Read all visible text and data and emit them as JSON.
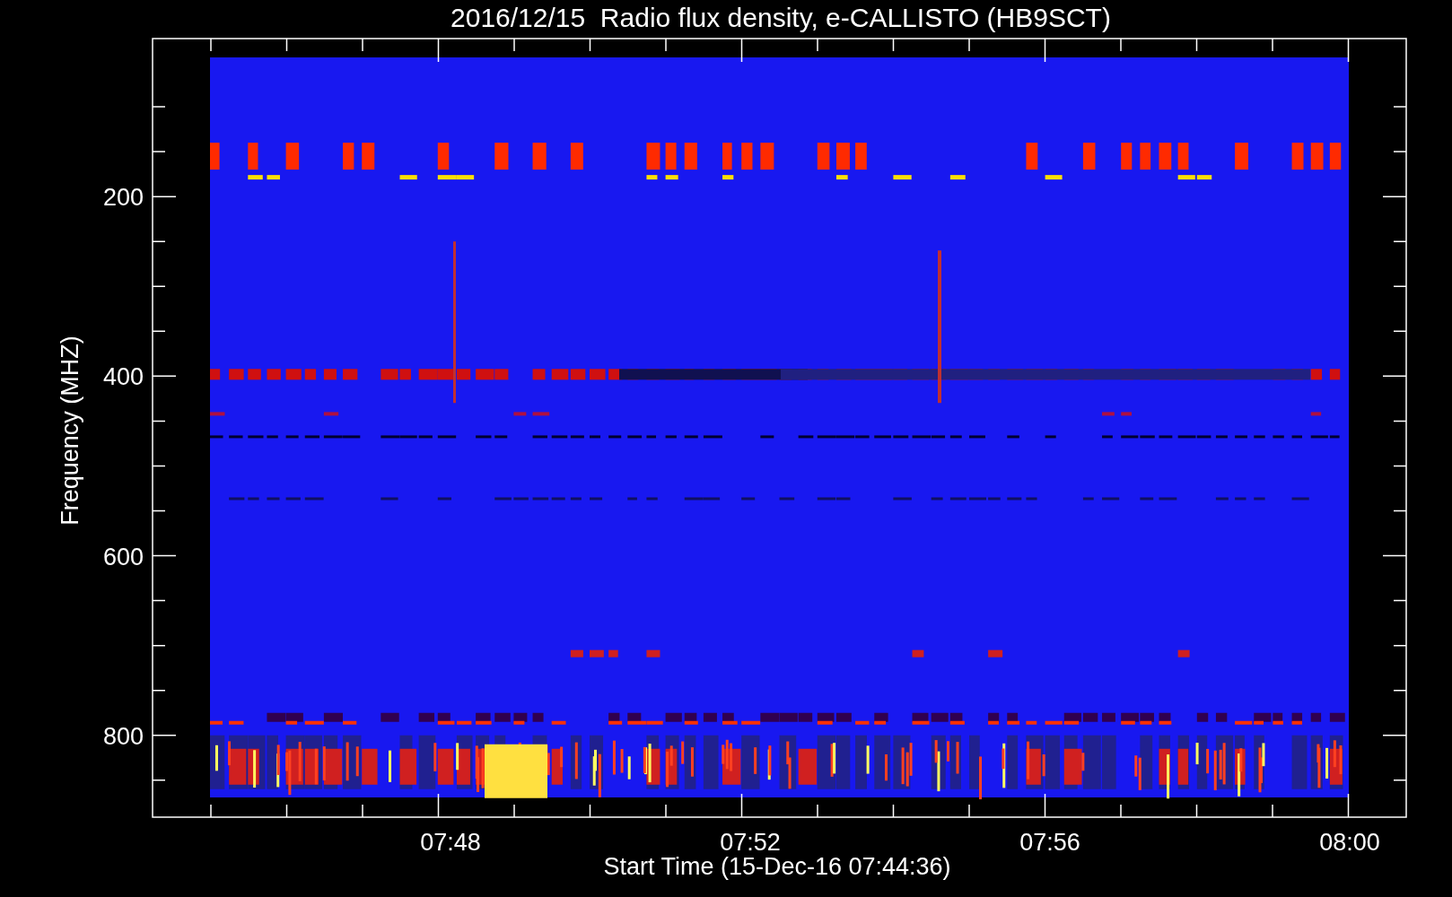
{
  "title": "2016/12/15  Radio flux density, e-CALLISTO (HB9SCT)",
  "y_axis": {
    "label": "Frequency (MHZ)",
    "ticks": [
      "200",
      "400",
      "600",
      "800"
    ]
  },
  "x_axis": {
    "label": "Start Time (15-Dec-16 07:44:36)",
    "ticks": [
      "07:48",
      "07:52",
      "07:56",
      "08:00"
    ]
  }
}
